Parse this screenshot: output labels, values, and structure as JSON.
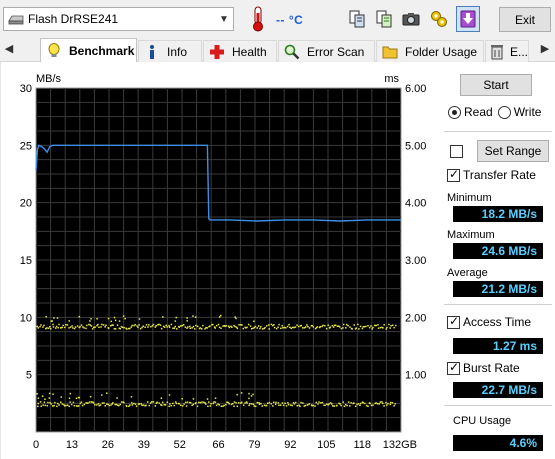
{
  "toolbar": {
    "drive": "Flash DrRSE241",
    "temperature": "-- °C",
    "exit_label": "Exit",
    "icons": [
      "copy-info-icon",
      "copy-text-icon",
      "screenshot-icon",
      "options-icon",
      "save-icon"
    ]
  },
  "tabs": {
    "items": [
      {
        "label": "Benchmark",
        "icon": "benchmark-icon"
      },
      {
        "label": "Info",
        "icon": "info-icon"
      },
      {
        "label": "Health",
        "icon": "health-icon"
      },
      {
        "label": "Error Scan",
        "icon": "error-scan-icon"
      },
      {
        "label": "Folder Usage",
        "icon": "folder-icon"
      },
      {
        "label": "E...",
        "icon": "erase-icon"
      }
    ],
    "active": "Benchmark"
  },
  "side": {
    "start_label": "Start",
    "read_label": "Read",
    "write_label": "Write",
    "mode": "Read",
    "set_range_label": "Set Range",
    "transfer_rate_label": "Transfer Rate",
    "minimum_label": "Minimum",
    "minimum_value": "18.2 MB/s",
    "maximum_label": "Maximum",
    "maximum_value": "24.6 MB/s",
    "average_label": "Average",
    "average_value": "21.2 MB/s",
    "access_time_label": "Access Time",
    "access_time_value": "1.27 ms",
    "burst_rate_label": "Burst Rate",
    "burst_rate_value": "22.7 MB/s",
    "cpu_usage_label": "CPU Usage",
    "cpu_usage_value": "4.6%"
  },
  "chart_data": {
    "type": "line",
    "ylabel": "MB/s",
    "y2label": "ms",
    "ylim": [
      0,
      30
    ],
    "y2lim": [
      0,
      6
    ],
    "xlim": [
      0,
      132
    ],
    "yticks": [
      "30",
      "25",
      "20",
      "15",
      "10",
      "5",
      ""
    ],
    "y2ticks": [
      "6.00",
      "5.00",
      "4.00",
      "3.00",
      "2.00",
      "1.00",
      ""
    ],
    "xticks": [
      "0",
      "13",
      "26",
      "39",
      "52",
      "66",
      "79",
      "92",
      "105",
      "118",
      "132GB"
    ],
    "grid": true,
    "background": "#000000",
    "series": [
      {
        "color": "#3c8fe6",
        "x": [
          0,
          0.5,
          1,
          2,
          3,
          4,
          5,
          6,
          8,
          10,
          15,
          20,
          30,
          40,
          50,
          60,
          62,
          62.5,
          63,
          65,
          70,
          80,
          90,
          100,
          110,
          120,
          130,
          132
        ],
        "y": [
          22.8,
          24.6,
          25.0,
          24.9,
          24.7,
          24.4,
          24.9,
          25.0,
          25.0,
          25.0,
          25.0,
          25.0,
          25.0,
          25.0,
          25.0,
          25.0,
          25.0,
          18.6,
          18.5,
          18.5,
          18.5,
          18.4,
          18.5,
          18.5,
          18.4,
          18.5,
          18.5,
          18.5
        ]
      },
      {
        "name": "Access Time",
        "color": "#e8e84a",
        "bands": [
          {
            "x_range": [
              0,
              132
            ],
            "y": 1.85,
            "spread": 0.04
          },
          {
            "x_range": [
              0,
              132
            ],
            "y": 0.5,
            "spread": 0.04
          }
        ]
      }
    ]
  }
}
